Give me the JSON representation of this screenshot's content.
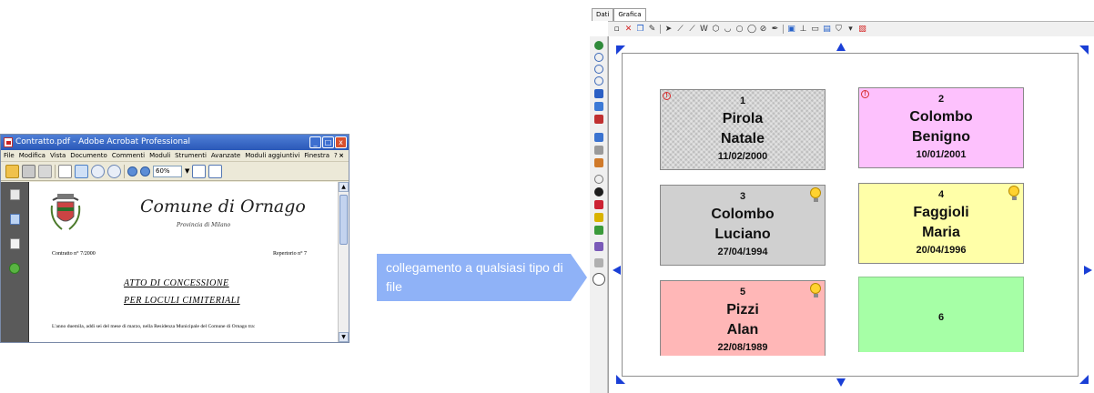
{
  "acrobat": {
    "title": "Contratto.pdf - Adobe Acrobat Professional",
    "menu": [
      "File",
      "Modifica",
      "Vista",
      "Documento",
      "Commenti",
      "Moduli",
      "Strumenti",
      "Avanzate",
      "Moduli aggiuntivi",
      "Finestra",
      "?"
    ],
    "zoom": "60%",
    "document": {
      "comune": "Comune di Ornago",
      "provincia": "Provincia di Milano",
      "contratto": "Contratto n° 7/2000",
      "repertorio": "Repertorio n° 7",
      "title_line1": "ATTO DI CONCESSIONE",
      "title_line2": "PER LOCULI CIMITERIALI",
      "first_line": "L'anno duemila, addì sei del mese di marzo, nella Residenza Municipale del Comune di Ornago tra:"
    }
  },
  "callout": {
    "text": "collegamento a qualsiasi tipo di file",
    "color": "#8fb2f7"
  },
  "panel": {
    "tabs": [
      "Dati",
      "Grafica"
    ],
    "active_tab": "Grafica",
    "loculi": [
      {
        "number": "1",
        "surname": "Pirola",
        "name": "Natale",
        "date": "11/02/2000",
        "color": "#bdbdbd",
        "warning": true,
        "bulb": false
      },
      {
        "number": "2",
        "surname": "Colombo",
        "name": "Benigno",
        "date": "10/01/2001",
        "color": "#fdc1fd",
        "warning": true,
        "bulb": false
      },
      {
        "number": "3",
        "surname": "Colombo",
        "name": "Luciano",
        "date": "27/04/1994",
        "color": "#d0d0d0",
        "warning": false,
        "bulb": true
      },
      {
        "number": "4",
        "surname": "Faggioli",
        "name": "Maria",
        "date": "20/04/1996",
        "color": "#ffffa8",
        "warning": false,
        "bulb": true
      },
      {
        "number": "5",
        "surname": "Pizzi",
        "name": "Alan",
        "date": "22/08/1989",
        "color": "#ffb7b7",
        "warning": false,
        "bulb": true
      },
      {
        "number": "6",
        "surname": "",
        "name": "",
        "date": "",
        "color": "#a6ffa6",
        "warning": false,
        "bulb": false
      }
    ],
    "handle_color": "#1a3fd6"
  }
}
